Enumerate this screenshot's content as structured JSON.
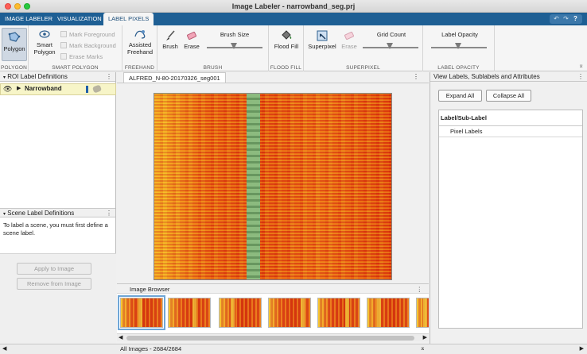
{
  "window": {
    "title": "Image Labeler - narrowband_seg.prj"
  },
  "tabs": [
    {
      "label": "IMAGE LABELER"
    },
    {
      "label": "VISUALIZATION"
    },
    {
      "label": "LABEL PIXELS"
    }
  ],
  "ribbon": {
    "polygon_label": "Polygon",
    "polygon_group": "POLYGON",
    "smart_polygon_label": "Smart Polygon",
    "mark_foreground": "Mark Foreground",
    "mark_background": "Mark Background",
    "erase_marks": "Erase Marks",
    "smart_polygon_group": "SMART POLYGON",
    "assisted_freehand_label": "Assisted Freehand",
    "freehand_group": "FREEHAND",
    "brush_label": "Brush",
    "erase_label": "Erase",
    "brush_size_label": "Brush Size",
    "brush_group": "BRUSH",
    "flood_fill_label": "Flood Fill",
    "flood_fill_group": "FLOOD FILL",
    "superpixel_label": "Superpixel",
    "superpixel_erase_label": "Erase",
    "grid_count_label": "Grid Count",
    "superpixel_group": "SUPERPIXEL",
    "label_opacity_label": "Label Opacity",
    "label_opacity_group": "LABEL OPACITY"
  },
  "roi_panel": {
    "title": "ROI Label Definitions",
    "labels": [
      {
        "name": "Narrowband",
        "color": "#1f5fa8"
      }
    ]
  },
  "scene_panel": {
    "title": "Scene Label Definitions",
    "message": "To label a scene, you must first define a scene label.",
    "apply_button": "Apply to Image",
    "remove_button": "Remove from Image"
  },
  "document": {
    "tab_label": "ALFRED_N-80-20170326_seg001",
    "band_color": "#7ab07a"
  },
  "image_browser": {
    "title": "Image Browser",
    "thumbnail_count": 7,
    "selected_index": 0
  },
  "right_panel": {
    "title": "View Labels, Sublabels and Attributes",
    "expand_all": "Expand All",
    "collapse_all": "Collapse All",
    "column_header": "Label/Sub-Label",
    "rows": [
      {
        "label": "Pixel Labels"
      }
    ]
  },
  "status": {
    "text": "All Images - 2684/2684"
  }
}
